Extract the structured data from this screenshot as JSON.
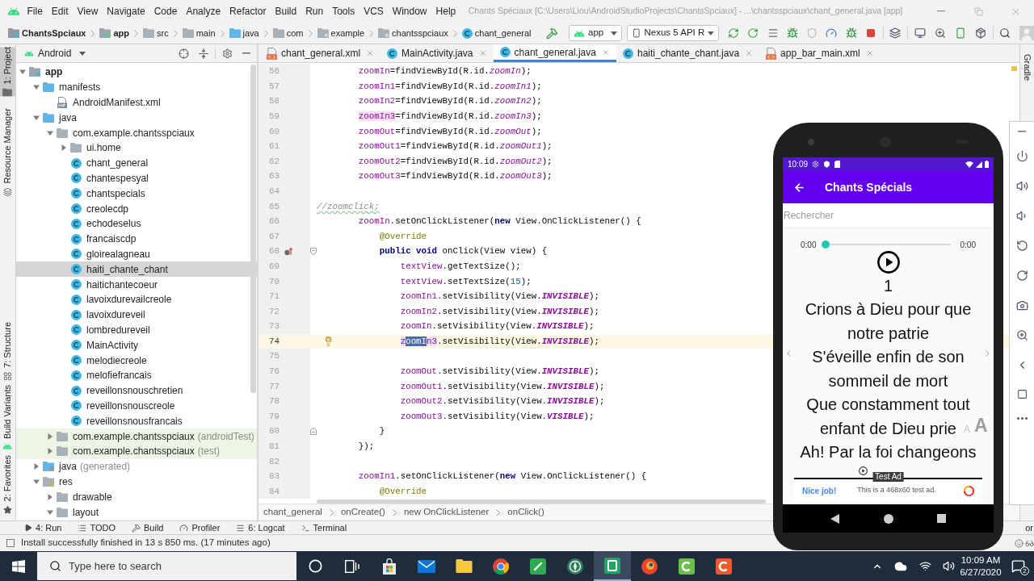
{
  "window": {
    "title": "Chants Spéciaux [C:\\Users\\Liou\\AndroidStudioProjects\\ChantsSpciaux] - ...\\chantsspciaux\\chant_general.java [app]"
  },
  "menu": [
    "File",
    "Edit",
    "View",
    "Navigate",
    "Code",
    "Analyze",
    "Refactor",
    "Build",
    "Run",
    "Tools",
    "VCS",
    "Window",
    "Help"
  ],
  "navigation_bar": {
    "breadcrumb": [
      {
        "label": "ChantsSpciaux",
        "kind": "project"
      },
      {
        "label": "app",
        "kind": "module"
      },
      {
        "label": "src",
        "kind": "folder"
      },
      {
        "label": "main",
        "kind": "folder"
      },
      {
        "label": "java",
        "kind": "source"
      },
      {
        "label": "com",
        "kind": "folder"
      },
      {
        "label": "example",
        "kind": "package"
      },
      {
        "label": "chantsspciaux",
        "kind": "package"
      },
      {
        "label": "chant_general",
        "kind": "class"
      }
    ],
    "run_configuration": "app",
    "device": "Nexus 5 API R"
  },
  "left_tool_strip": [
    {
      "label": "1: Project",
      "kind": "project",
      "selected": true
    },
    {
      "label": "Resource Manager",
      "kind": "resources",
      "selected": false
    },
    {
      "label": "7: Structure",
      "kind": "structure",
      "selected": false
    },
    {
      "label": "Build Variants",
      "kind": "variants",
      "selected": false
    },
    {
      "label": "2: Favorites",
      "kind": "favorites",
      "selected": false
    }
  ],
  "project_panel": {
    "view": "Android",
    "tree": [
      {
        "label": "app",
        "kind": "module",
        "expanded": true,
        "selected": false,
        "children": [
          {
            "label": "manifests",
            "kind": "folder",
            "expanded": true,
            "selected": false,
            "children": [
              {
                "label": "AndroidManifest.xml",
                "kind": "manifest",
                "selected": false
              }
            ]
          },
          {
            "label": "java",
            "kind": "folder",
            "expanded": true,
            "selected": false,
            "children": [
              {
                "label": "com.example.chantsspciaux",
                "kind": "package",
                "expanded": true,
                "selected": false,
                "children": [
                  {
                    "label": "ui.home",
                    "kind": "package",
                    "expanded": false,
                    "selected": false
                  },
                  {
                    "label": "chant_general",
                    "kind": "class",
                    "selected": false
                  },
                  {
                    "label": "chantespesyal",
                    "kind": "class",
                    "selected": false
                  },
                  {
                    "label": "chantspecials",
                    "kind": "class",
                    "selected": false
                  },
                  {
                    "label": "creolecdp",
                    "kind": "class",
                    "selected": false
                  },
                  {
                    "label": "echodeselus",
                    "kind": "class",
                    "selected": false
                  },
                  {
                    "label": "francaiscdp",
                    "kind": "class",
                    "selected": false
                  },
                  {
                    "label": "gloirealagneau",
                    "kind": "class",
                    "selected": false
                  },
                  {
                    "label": "haiti_chante_chant",
                    "kind": "class",
                    "selected": true
                  },
                  {
                    "label": "haitichantecoeur",
                    "kind": "class",
                    "selected": false
                  },
                  {
                    "label": "lavoixdurevailcreole",
                    "kind": "class",
                    "selected": false
                  },
                  {
                    "label": "lavoixdureveil",
                    "kind": "class",
                    "selected": false
                  },
                  {
                    "label": "lombredureveil",
                    "kind": "class",
                    "selected": false
                  },
                  {
                    "label": "MainActivity",
                    "kind": "class",
                    "selected": false
                  },
                  {
                    "label": "melodiecreole",
                    "kind": "class",
                    "selected": false
                  },
                  {
                    "label": "melofiefrancais",
                    "kind": "class",
                    "selected": false
                  },
                  {
                    "label": "reveillonsnouschretien",
                    "kind": "class",
                    "selected": false
                  },
                  {
                    "label": "reveillonsnouscreole",
                    "kind": "class",
                    "selected": false
                  },
                  {
                    "label": "reveillonsnousfrancais",
                    "kind": "class",
                    "selected": false
                  }
                ]
              },
              {
                "label": "com.example.chantsspciaux",
                "suffix": "(androidTest)",
                "kind": "test_package",
                "expanded": false,
                "selected": false
              },
              {
                "label": "com.example.chantsspciaux",
                "suffix": "(test)",
                "kind": "test_package",
                "expanded": false,
                "selected": false
              }
            ]
          },
          {
            "label": "java",
            "suffix": "(generated)",
            "kind": "generated",
            "expanded": false,
            "selected": false
          },
          {
            "label": "res",
            "kind": "resources",
            "expanded": true,
            "selected": false,
            "children": [
              {
                "label": "drawable",
                "kind": "package",
                "expanded": false,
                "selected": false
              },
              {
                "label": "layout",
                "kind": "package",
                "expanded": true,
                "selected": false
              }
            ]
          }
        ]
      }
    ]
  },
  "editor_tabs": [
    {
      "label": "chant_general.xml",
      "kind": "xml",
      "selected": false
    },
    {
      "label": "MainActivity.java",
      "kind": "class",
      "selected": false
    },
    {
      "label": "chant_general.java",
      "kind": "class",
      "selected": true
    },
    {
      "label": "haiti_chante_chant.java",
      "kind": "class",
      "selected": false
    },
    {
      "label": "app_bar_main.xml",
      "kind": "xml",
      "selected": false
    }
  ],
  "editor": {
    "lines": [
      {
        "number": "56",
        "kind": "code",
        "current": false,
        "tokens": [
          {
            "text": "        zoomIn",
            "kind": "field"
          },
          {
            "text": "=findViewById(R.id.",
            "kind": "plain"
          },
          {
            "text": "zoomIn",
            "kind": "static"
          },
          {
            "text": ");",
            "kind": "plain"
          }
        ]
      },
      {
        "number": "57",
        "kind": "code",
        "current": false,
        "tokens": [
          {
            "text": "        zoomIn1",
            "kind": "field"
          },
          {
            "text": "=findViewById(R.id.",
            "kind": "plain"
          },
          {
            "text": "zoomIn1",
            "kind": "static"
          },
          {
            "text": ");",
            "kind": "plain"
          }
        ]
      },
      {
        "number": "58",
        "kind": "code",
        "current": false,
        "tokens": [
          {
            "text": "        zoomIn2",
            "kind": "field"
          },
          {
            "text": "=findViewById(R.id.",
            "kind": "plain"
          },
          {
            "text": "zoomIn2",
            "kind": "static"
          },
          {
            "text": ");",
            "kind": "plain"
          }
        ]
      },
      {
        "number": "59",
        "kind": "code",
        "current": false,
        "tokens": [
          {
            "text": "        zoomIn3",
            "kind": "field_write"
          },
          {
            "text": "=findViewById(R.id.",
            "kind": "plain"
          },
          {
            "text": "zoomIn3",
            "kind": "static"
          },
          {
            "text": ");",
            "kind": "plain"
          }
        ]
      },
      {
        "number": "60",
        "kind": "code",
        "current": false,
        "tokens": [
          {
            "text": "        zoomOut",
            "kind": "field"
          },
          {
            "text": "=findViewById(R.id.",
            "kind": "plain"
          },
          {
            "text": "zoomOut",
            "kind": "static"
          },
          {
            "text": ");",
            "kind": "plain"
          }
        ]
      },
      {
        "number": "61",
        "kind": "code",
        "current": false,
        "tokens": [
          {
            "text": "        zoomOut1",
            "kind": "field"
          },
          {
            "text": "=findViewById(R.id.",
            "kind": "plain"
          },
          {
            "text": "zoomOut1",
            "kind": "static"
          },
          {
            "text": ");",
            "kind": "plain"
          }
        ]
      },
      {
        "number": "62",
        "kind": "code",
        "current": false,
        "tokens": [
          {
            "text": "        zoomOut2",
            "kind": "field"
          },
          {
            "text": "=findViewById(R.id.",
            "kind": "plain"
          },
          {
            "text": "zoomOut2",
            "kind": "static"
          },
          {
            "text": ");",
            "kind": "plain"
          }
        ]
      },
      {
        "number": "63",
        "kind": "code",
        "current": false,
        "tokens": [
          {
            "text": "        zoomOut3",
            "kind": "field"
          },
          {
            "text": "=findViewById(R.id.",
            "kind": "plain"
          },
          {
            "text": "zoomOut3",
            "kind": "static"
          },
          {
            "text": ");",
            "kind": "plain"
          }
        ]
      },
      {
        "number": "64",
        "kind": "blank",
        "current": false
      },
      {
        "number": "65",
        "kind": "code",
        "current": false,
        "tokens": [
          {
            "text": "//zoomclick;",
            "kind": "typo_comment"
          }
        ]
      },
      {
        "number": "66",
        "kind": "code",
        "current": false,
        "tokens": [
          {
            "text": "        zoomIn",
            "kind": "field"
          },
          {
            "text": ".setOnClickListener(",
            "kind": "plain"
          },
          {
            "text": "new",
            "kind": "keyword"
          },
          {
            "text": " View.OnClickListener() {",
            "kind": "plain"
          }
        ]
      },
      {
        "number": "67",
        "kind": "code",
        "current": false,
        "tokens": [
          {
            "text": "            @Override",
            "kind": "annotation"
          }
        ]
      },
      {
        "number": "68",
        "kind": "method",
        "current": false,
        "tokens": [
          {
            "text": "            public void",
            "kind": "keyword"
          },
          {
            "text": " onClick(View view) {",
            "kind": "plain"
          }
        ]
      },
      {
        "number": "69",
        "kind": "code",
        "current": false,
        "tokens": [
          {
            "text": "                textView",
            "kind": "field"
          },
          {
            "text": ".getTextSize();",
            "kind": "plain"
          }
        ]
      },
      {
        "number": "70",
        "kind": "code",
        "current": false,
        "tokens": [
          {
            "text": "                textView",
            "kind": "field"
          },
          {
            "text": ".setTextSize(",
            "kind": "plain"
          },
          {
            "text": "15",
            "kind": "number"
          },
          {
            "text": ");",
            "kind": "plain"
          }
        ]
      },
      {
        "number": "71",
        "kind": "code",
        "current": false,
        "tokens": [
          {
            "text": "                zoomIn1",
            "kind": "field"
          },
          {
            "text": ".setVisibility(View.",
            "kind": "plain"
          },
          {
            "text": "INVISIBLE",
            "kind": "constant"
          },
          {
            "text": ");",
            "kind": "plain"
          }
        ]
      },
      {
        "number": "72",
        "kind": "code",
        "current": false,
        "tokens": [
          {
            "text": "                zoomIn2",
            "kind": "field"
          },
          {
            "text": ".setVisibility(View.",
            "kind": "plain"
          },
          {
            "text": "INVISIBLE",
            "kind": "constant"
          },
          {
            "text": ");",
            "kind": "plain"
          }
        ]
      },
      {
        "number": "73",
        "kind": "code",
        "current": false,
        "tokens": [
          {
            "text": "                zoomIn",
            "kind": "field"
          },
          {
            "text": ".setVisibility(View.",
            "kind": "plain"
          },
          {
            "text": "INVISIBLE",
            "kind": "constant"
          },
          {
            "text": ");",
            "kind": "plain"
          }
        ]
      },
      {
        "number": "74",
        "kind": "intention",
        "current": true,
        "tokens": [
          {
            "text": "                z",
            "kind": "field_usage"
          },
          {
            "text": "oomI",
            "kind": "selection"
          },
          {
            "text": "n3",
            "kind": "field_usage"
          },
          {
            "text": ".setVisibility(View.",
            "kind": "plain"
          },
          {
            "text": "INVISIBLE",
            "kind": "constant"
          },
          {
            "text": ");",
            "kind": "plain"
          }
        ]
      },
      {
        "number": "75",
        "kind": "blank",
        "current": false
      },
      {
        "number": "76",
        "kind": "code",
        "current": false,
        "tokens": [
          {
            "text": "                zoomOut",
            "kind": "field"
          },
          {
            "text": ".setVisibility(View.",
            "kind": "plain"
          },
          {
            "text": "INVISIBLE",
            "kind": "constant"
          },
          {
            "text": ");",
            "kind": "plain"
          }
        ]
      },
      {
        "number": "77",
        "kind": "code",
        "current": false,
        "tokens": [
          {
            "text": "                zoomOut1",
            "kind": "field"
          },
          {
            "text": ".setVisibility(View.",
            "kind": "plain"
          },
          {
            "text": "INVISIBLE",
            "kind": "constant"
          },
          {
            "text": ");",
            "kind": "plain"
          }
        ]
      },
      {
        "number": "78",
        "kind": "code",
        "current": false,
        "tokens": [
          {
            "text": "                zoomOut2",
            "kind": "field"
          },
          {
            "text": ".setVisibility(View.",
            "kind": "plain"
          },
          {
            "text": "INVISIBLE",
            "kind": "constant"
          },
          {
            "text": ");",
            "kind": "plain"
          }
        ]
      },
      {
        "number": "79",
        "kind": "code",
        "current": false,
        "tokens": [
          {
            "text": "                zoomOut3",
            "kind": "field"
          },
          {
            "text": ".setVisibility(View.",
            "kind": "plain"
          },
          {
            "text": "VISIBLE",
            "kind": "constant"
          },
          {
            "text": ");",
            "kind": "plain"
          }
        ]
      },
      {
        "number": "80",
        "kind": "block_end",
        "current": false,
        "tokens": [
          {
            "text": "            }",
            "kind": "plain"
          }
        ]
      },
      {
        "number": "81",
        "kind": "code",
        "current": false,
        "tokens": [
          {
            "text": "        });",
            "kind": "plain"
          }
        ]
      },
      {
        "number": "82",
        "kind": "blank",
        "current": false
      },
      {
        "number": "83",
        "kind": "code",
        "current": false,
        "tokens": [
          {
            "text": "        zoomIn1",
            "kind": "field"
          },
          {
            "text": ".setOnClickListener(",
            "kind": "plain"
          },
          {
            "text": "new",
            "kind": "keyword"
          },
          {
            "text": " View.OnClickListener() {",
            "kind": "plain"
          }
        ]
      },
      {
        "number": "84",
        "kind": "code",
        "current": false,
        "tokens": [
          {
            "text": "            @Override",
            "kind": "annotation"
          }
        ]
      }
    ],
    "breadcrumb": [
      "chant_general",
      "onCreate()",
      "new OnClickListener",
      "onClick()"
    ]
  },
  "right_tool_strip": [
    "Gradle"
  ],
  "emulator": {
    "status_time": "10:09",
    "app_bar": {
      "title": "Chants Spécials"
    },
    "search": {
      "placeholder": "Rechercher"
    },
    "player": {
      "elapsed": "0:00",
      "duration": "0:00",
      "level": 0
    },
    "song_number": "1",
    "lyrics": [
      "Crions à Dieu pour que",
      "notre patrie",
      "S'éveille enfin de son",
      "sommeil de mort",
      "Que constamment tout",
      "enfant de Dieu prie",
      "Ah! Par la foi changeons"
    ],
    "text_size_buttons": [
      {
        "label": "A",
        "kind": "small"
      },
      {
        "label": "A",
        "kind": "large"
      }
    ],
    "ad": {
      "badge": "Test Ad",
      "headline": "Nice job!",
      "text": "This is a 468x60 test ad."
    }
  },
  "bottom_tool_tabs": [
    {
      "label": "4: Run",
      "kind": "run"
    },
    {
      "label": "TODO",
      "kind": "todo"
    },
    {
      "label": "Build",
      "kind": "build"
    },
    {
      "label": "Profiler",
      "kind": "profiler"
    },
    {
      "label": "6: Logcat",
      "kind": "logcat"
    },
    {
      "label": "Terminal",
      "kind": "terminal"
    },
    {
      "label": "or",
      "kind": "cut"
    }
  ],
  "status_bar": {
    "message": "Install successfully finished in 13 s 850 ms. (17 minutes ago)"
  },
  "taskbar": {
    "search": {
      "placeholder": "Type here to search"
    },
    "apps": [
      {
        "kind": "ring",
        "active": false
      },
      {
        "kind": "taskview",
        "active": false
      },
      {
        "kind": "store",
        "active": false
      },
      {
        "kind": "mail",
        "active": false
      },
      {
        "kind": "explorer",
        "active": false
      },
      {
        "kind": "browser",
        "active": false
      },
      {
        "kind": "pen",
        "active": false
      },
      {
        "kind": "compass",
        "active": false
      },
      {
        "kind": "tile",
        "active": true
      },
      {
        "kind": "swirl",
        "active": false
      },
      {
        "kind": "cgreen",
        "active": false
      },
      {
        "kind": "cred",
        "active": false
      }
    ],
    "time": "10:09 AM",
    "date": "6/27/2020",
    "notifications": "2"
  }
}
